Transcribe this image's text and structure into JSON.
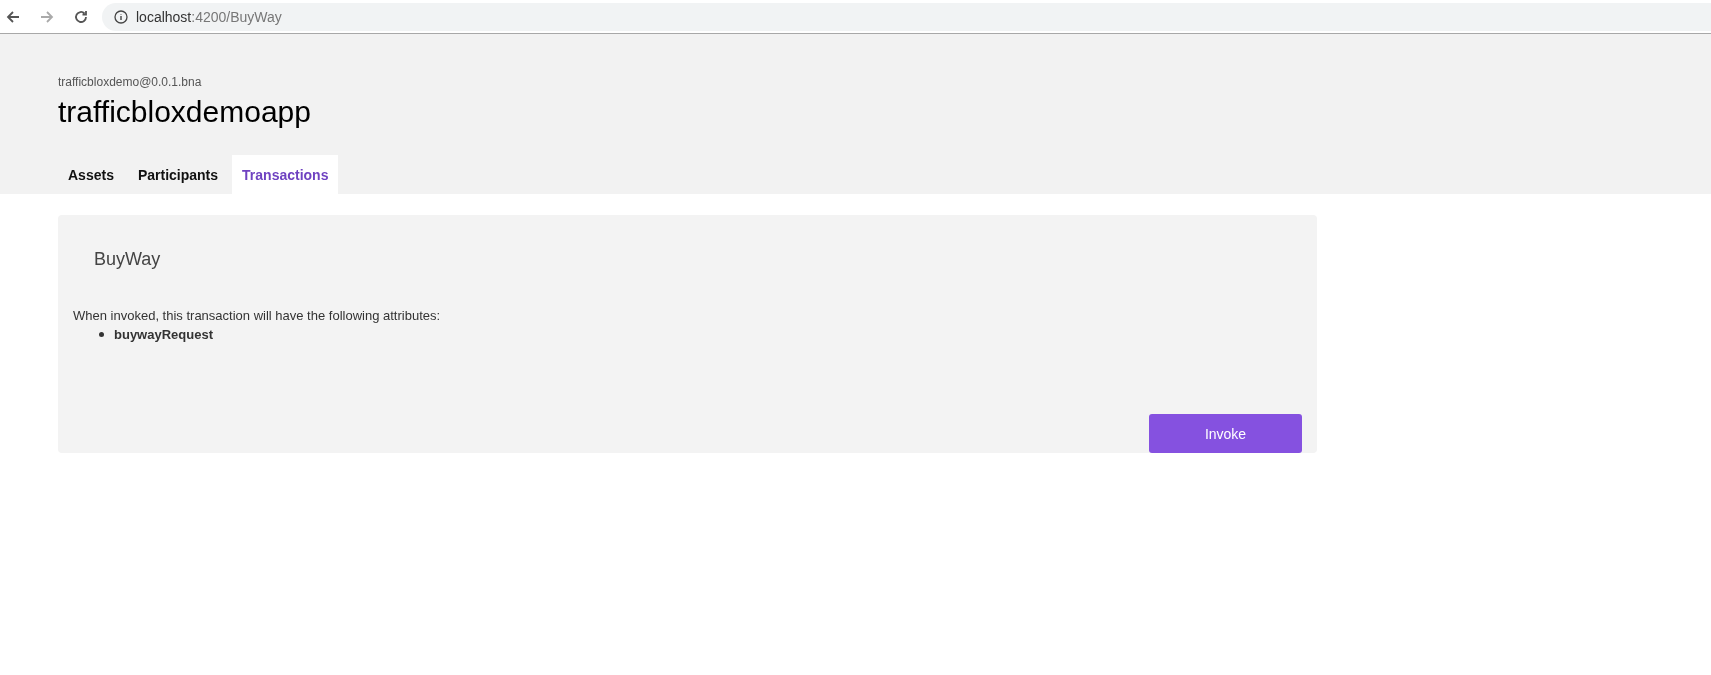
{
  "browser": {
    "url_host": "localhost",
    "url_path": ":4200/BuyWay"
  },
  "header": {
    "subtitle": "trafficbloxdemo@0.0.1.bna",
    "title": "trafficbloxdemoapp"
  },
  "tabs": [
    {
      "label": "Assets",
      "selected": false
    },
    {
      "label": "Participants",
      "selected": false
    },
    {
      "label": "Transactions",
      "selected": true
    }
  ],
  "card": {
    "title": "BuyWay",
    "description": "When invoked, this transaction will have the following attributes:",
    "attributes": [
      "buywayRequest"
    ],
    "button": "Invoke"
  }
}
